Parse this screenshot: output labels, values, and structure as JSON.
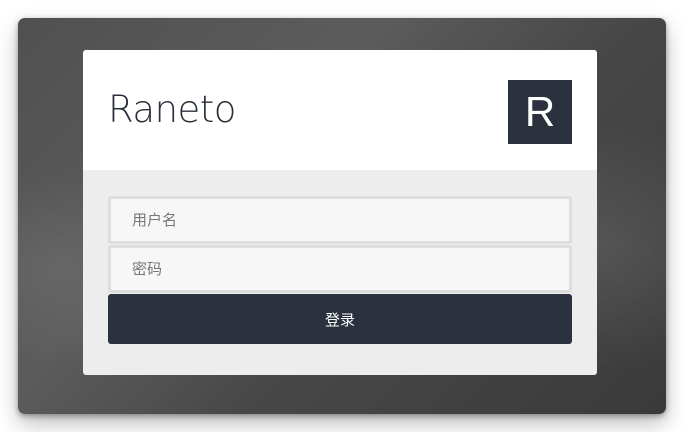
{
  "brand": {
    "title": "Raneto",
    "logo_letter": "R"
  },
  "login_form": {
    "username_placeholder": "用户名",
    "username_value": "",
    "password_placeholder": "密码",
    "password_value": "",
    "submit_label": "登录"
  },
  "colors": {
    "accent": "#2b313f",
    "card_body": "#ededed",
    "field_background": "#f7f7f7"
  }
}
